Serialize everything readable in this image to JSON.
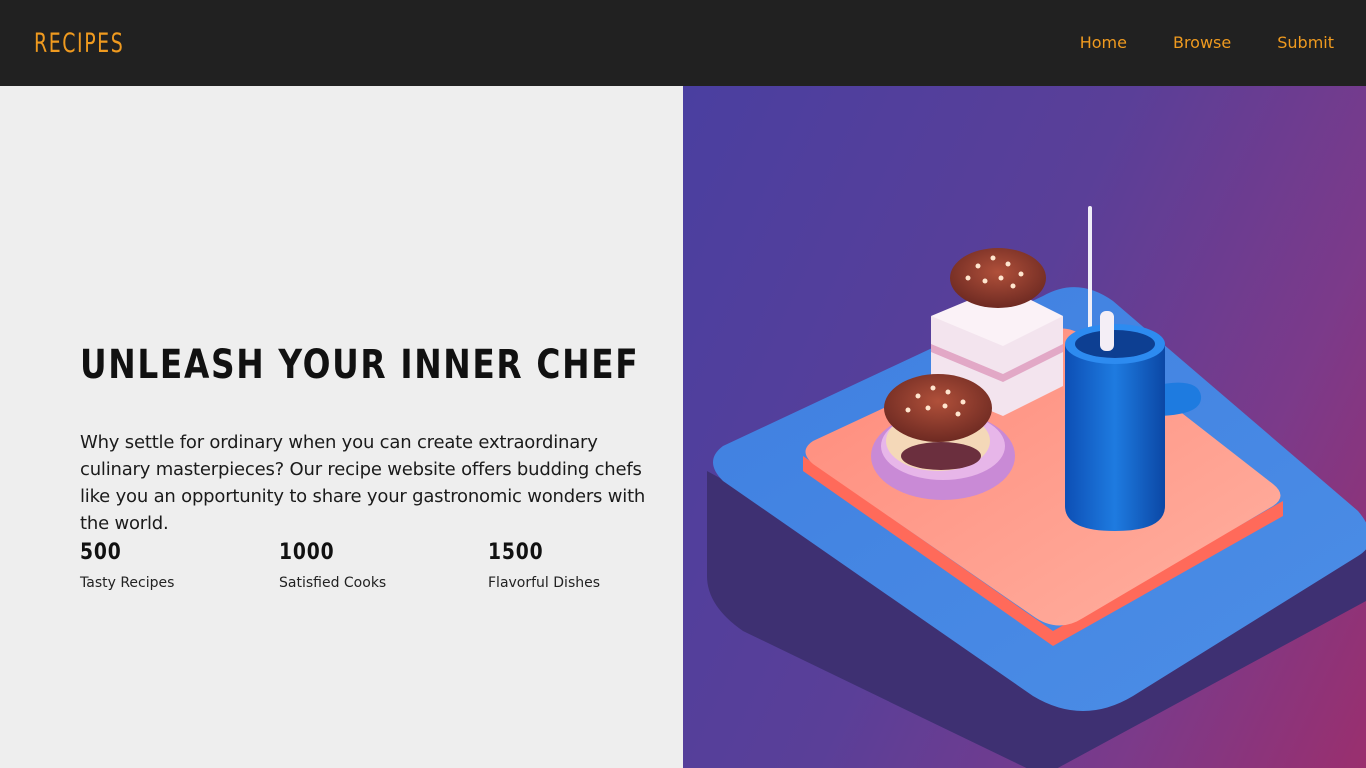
{
  "nav": {
    "brand": "RECIPES",
    "links": [
      "Home",
      "Browse",
      "Submit"
    ]
  },
  "hero": {
    "title": "UNLEASH YOUR INNER CHEF",
    "description": "Why settle for ordinary when you can create extraordinary culinary masterpieces? Our recipe website offers budding chefs like you an opportunity to share your gastronomic wonders with the world."
  },
  "stats": [
    {
      "value": "500",
      "label": "Tasty Recipes"
    },
    {
      "value": "1000",
      "label": "Satisfied Cooks"
    },
    {
      "value": "1500",
      "label": "Flavorful Dishes"
    }
  ],
  "colors": {
    "nav_bg": "#212121",
    "accent": "#ef9a1f",
    "page_bg": "#eeeeee"
  }
}
